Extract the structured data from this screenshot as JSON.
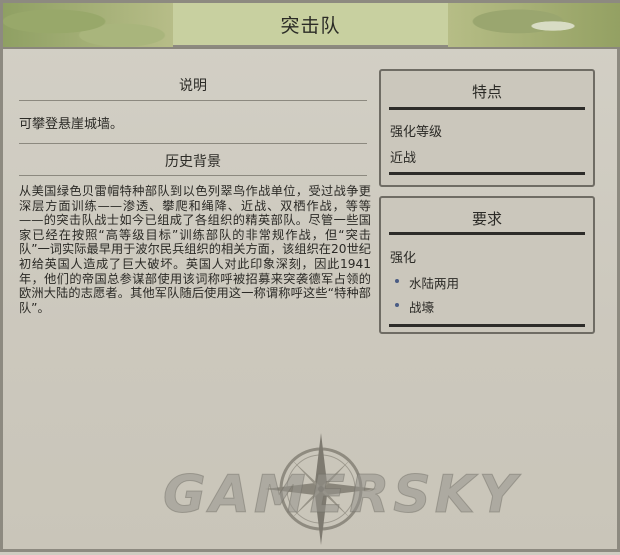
{
  "window": {
    "title": "突击队"
  },
  "description": {
    "heading": "说明",
    "text": "可攀登悬崖城墙。"
  },
  "history": {
    "heading": "历史背景",
    "text": "从美国绿色贝雷帽特种部队到以色列翠鸟作战单位，受过战争更深层方面训练——渗透、攀爬和绳降、近战、双栖作战，等等——的突击队战士如今已组成了各组织的精英部队。尽管一些国家已经在按照“高等级目标”训练部队的非常规作战，但“突击队”一词实际最早用于波尔民兵组织的相关方面，该组织在20世纪初给英国人造成了巨大破坏。英国人对此印象深刻，因此1941年，他们的帝国总参谋部使用该词称呼被招募来突袭德军占领的欧洲大陆的志愿者。其他军队随后使用这一称谓称呼这些“特种部队”。"
  },
  "traits": {
    "heading": "特点",
    "label": "强化等级",
    "value": "近战"
  },
  "requirements": {
    "heading": "要求",
    "label": "强化",
    "items": [
      "水陆两用",
      "战壕"
    ]
  },
  "watermark": "GAMERSKY",
  "icons": {
    "compass": "compass-rose-icon",
    "bullet": "bullet-dot-icon"
  },
  "colors": {
    "background": "#cfccc1",
    "title_plate": "#c8d0a0",
    "panel_rule": "#2d2c29",
    "bullet": "#4a5c84"
  }
}
